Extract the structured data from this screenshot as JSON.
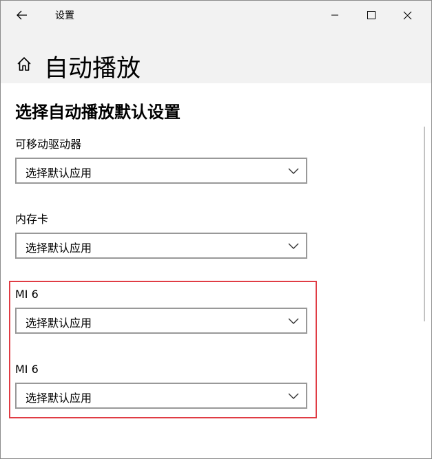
{
  "window": {
    "title": "设置"
  },
  "header": {
    "page_title": "自动播放"
  },
  "section": {
    "heading": "选择自动播放默认设置"
  },
  "groups": [
    {
      "label": "可移动驱动器",
      "selected": "选择默认应用"
    },
    {
      "label": "内存卡",
      "selected": "选择默认应用"
    },
    {
      "label": "MI 6",
      "selected": "选择默认应用"
    },
    {
      "label": "MI 6",
      "selected": "选择默认应用"
    }
  ],
  "icons": {
    "back": "back-arrow-icon",
    "home": "home-icon",
    "minimize": "minimize-icon",
    "maximize": "maximize-icon",
    "close": "close-icon",
    "chevron": "chevron-down-icon"
  },
  "colors": {
    "highlight": "#e03c44",
    "titlebar_bg": "#f2f2f2",
    "dropdown_border": "#999999"
  }
}
